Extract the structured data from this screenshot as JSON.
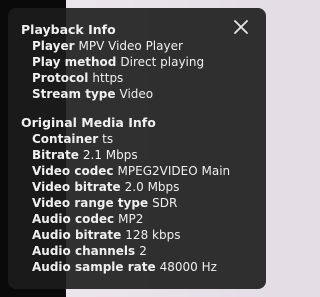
{
  "playback_info": {
    "title": "Playback Info",
    "rows": [
      {
        "label": "Player",
        "value": "MPV Video Player"
      },
      {
        "label": "Play method",
        "value": "Direct playing"
      },
      {
        "label": "Protocol",
        "value": "https"
      },
      {
        "label": "Stream type",
        "value": "Video"
      }
    ]
  },
  "original_media_info": {
    "title": "Original Media Info",
    "rows": [
      {
        "label": "Container",
        "value": "ts"
      },
      {
        "label": "Bitrate",
        "value": "2.1 Mbps"
      },
      {
        "label": "Video codec",
        "value": "MPEG2VIDEO Main"
      },
      {
        "label": "Video bitrate",
        "value": "2.0 Mbps"
      },
      {
        "label": "Video range type",
        "value": "SDR"
      },
      {
        "label": "Audio codec",
        "value": "MP2"
      },
      {
        "label": "Audio bitrate",
        "value": "128 kbps"
      },
      {
        "label": "Audio channels",
        "value": "2"
      },
      {
        "label": "Audio sample rate",
        "value": "48000 Hz"
      }
    ]
  },
  "icons": {
    "close": "close-icon"
  },
  "colors": {
    "panel_background": "#1c1c1c",
    "text": "#f0f0f0"
  }
}
